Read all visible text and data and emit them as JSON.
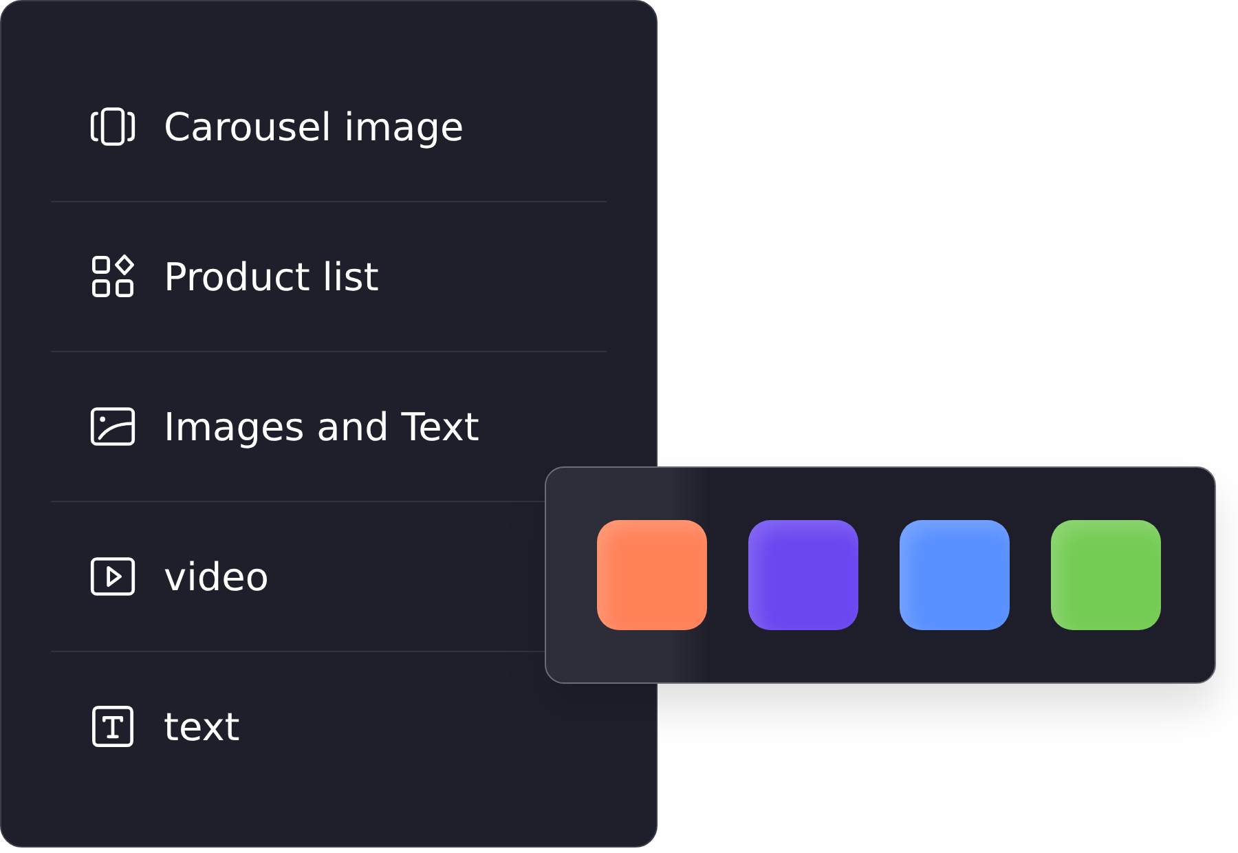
{
  "menu": {
    "items": [
      {
        "kind": "carousel",
        "label": "Carousel image"
      },
      {
        "kind": "grid",
        "label": "Product list"
      },
      {
        "kind": "image",
        "label": "Images and Text"
      },
      {
        "kind": "video",
        "label": "video"
      },
      {
        "kind": "text",
        "label": "text"
      }
    ]
  },
  "palette": {
    "swatches": [
      {
        "color": "#ff8259"
      },
      {
        "color": "#6a47f0"
      },
      {
        "color": "#5990ff"
      },
      {
        "color": "#75cc55"
      }
    ]
  }
}
